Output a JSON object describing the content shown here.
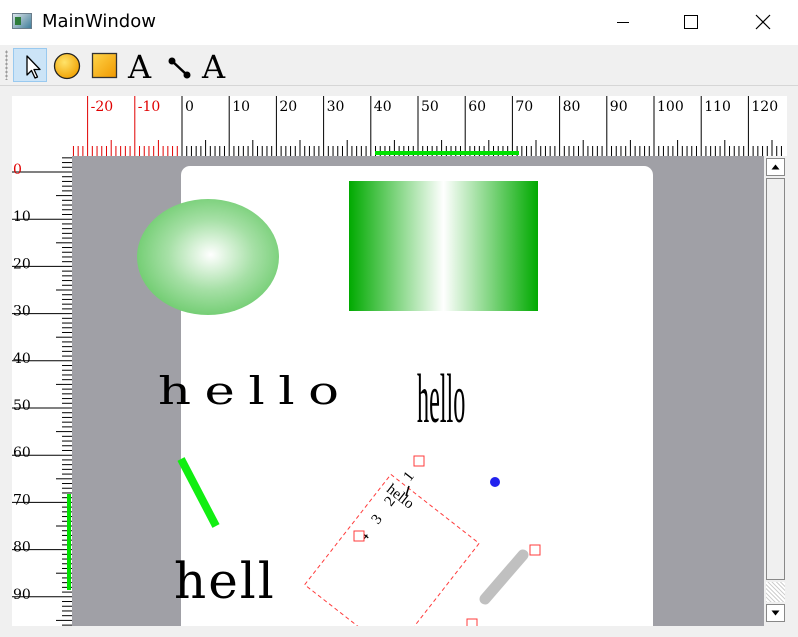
{
  "window": {
    "title": "MainWindow"
  },
  "toolbar": {
    "tools": [
      {
        "name": "select-tool",
        "icon": "arrow-pointer-icon",
        "active": true
      },
      {
        "name": "ellipse-tool",
        "icon": "circle-icon"
      },
      {
        "name": "rectangle-tool",
        "icon": "square-icon"
      },
      {
        "name": "text-tool",
        "label": "A",
        "icon": "text-icon"
      },
      {
        "name": "line-tool",
        "icon": "line-icon"
      },
      {
        "name": "rich-text-tool",
        "label": "A",
        "icon": "text-icon"
      }
    ]
  },
  "ruler": {
    "horizontal_labels": [
      "-20",
      "-10",
      "0",
      "10",
      "20",
      "30",
      "40",
      "50",
      "60",
      "70",
      "80",
      "90",
      "100",
      "110",
      "120"
    ],
    "vertical_labels": [
      "0",
      "10",
      "20",
      "30",
      "40",
      "50",
      "60",
      "70",
      "80",
      "90"
    ],
    "negative_color": "#e00000",
    "highlight_color": "#00e000"
  },
  "canvas": {
    "text_items": {
      "wide_hello": "hello",
      "tall_hello": "hello",
      "big_hell": "hell",
      "rotated_hello": "hello",
      "list_1": "1",
      "list_2": "2",
      "list_3": "3",
      "list_4": "4"
    },
    "colors": {
      "green": "#00aa00",
      "line_green": "#11ee11",
      "selection": "#ff3b3b",
      "handle": "#2222ee",
      "gray_line": "#c0c0c0"
    }
  }
}
